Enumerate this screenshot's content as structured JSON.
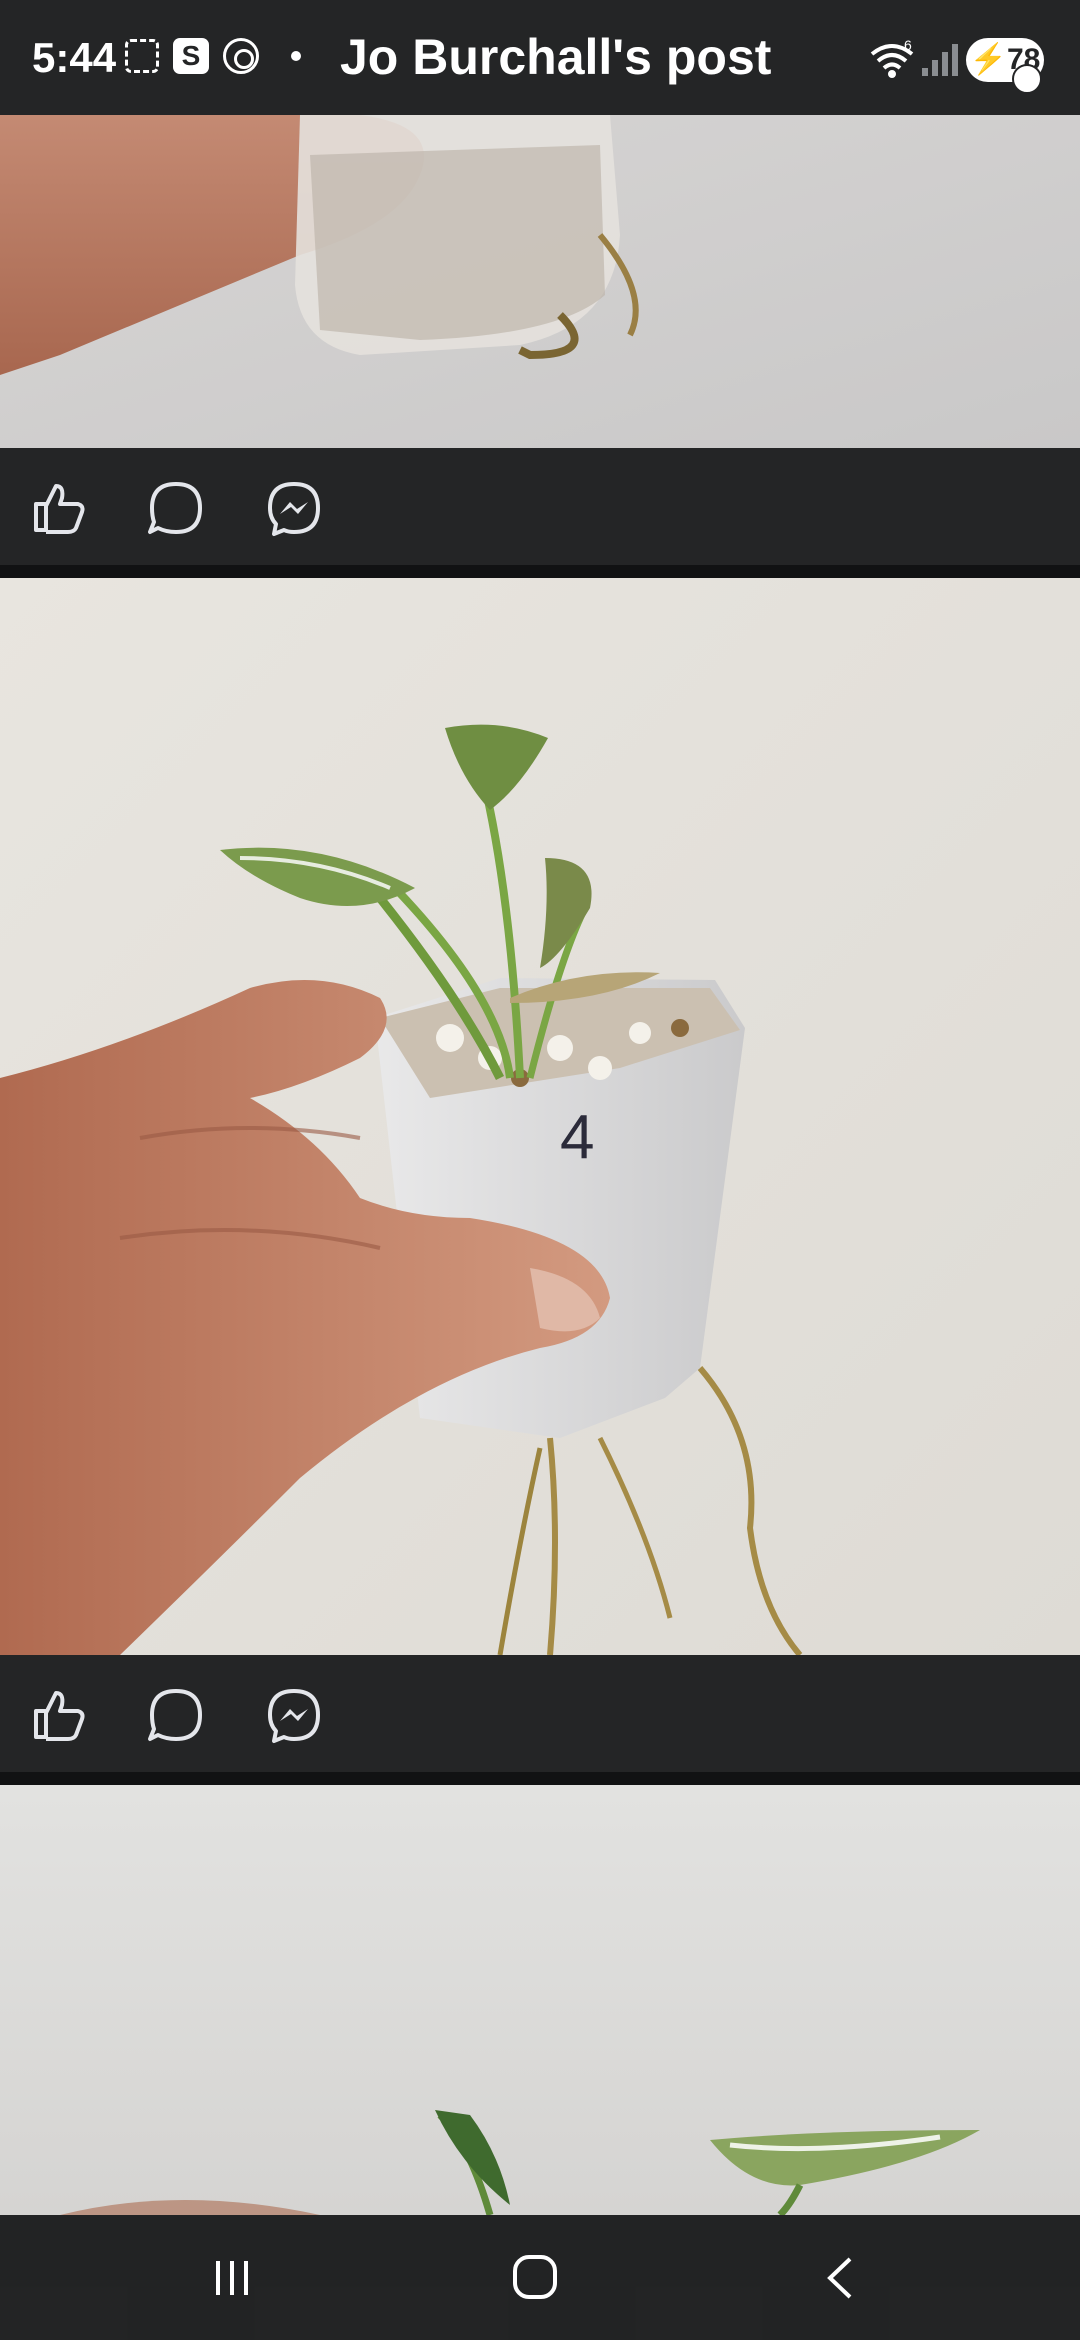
{
  "status_bar": {
    "time": "5:44",
    "title": "Jo Burchall's post",
    "wifi_superscript": "6",
    "battery_level": "78",
    "left_icons": [
      "screenshot-icon",
      "s-app-icon",
      "threads-icon"
    ],
    "right_icons": [
      "wifi-icon",
      "signal-icon",
      "battery-icon"
    ]
  },
  "photos": [
    {
      "content": "plant-cutting-pot-top-crop"
    },
    {
      "content": "hand-holding-plant-pot",
      "pot_label": "4"
    },
    {
      "content": "plant-cutting-partial"
    }
  ],
  "action_bars": [
    {
      "actions": [
        "like-icon",
        "comment-icon",
        "messenger-icon"
      ]
    },
    {
      "actions": [
        "like-icon",
        "comment-icon",
        "messenger-icon"
      ]
    }
  ],
  "nav_bar": {
    "buttons": [
      "recents-icon",
      "home-icon",
      "back-icon"
    ]
  },
  "colors": {
    "bar_background": "#242526",
    "divider": "#111213",
    "icon_stroke": "#e4e6eb",
    "wall": "#e3e0db"
  }
}
